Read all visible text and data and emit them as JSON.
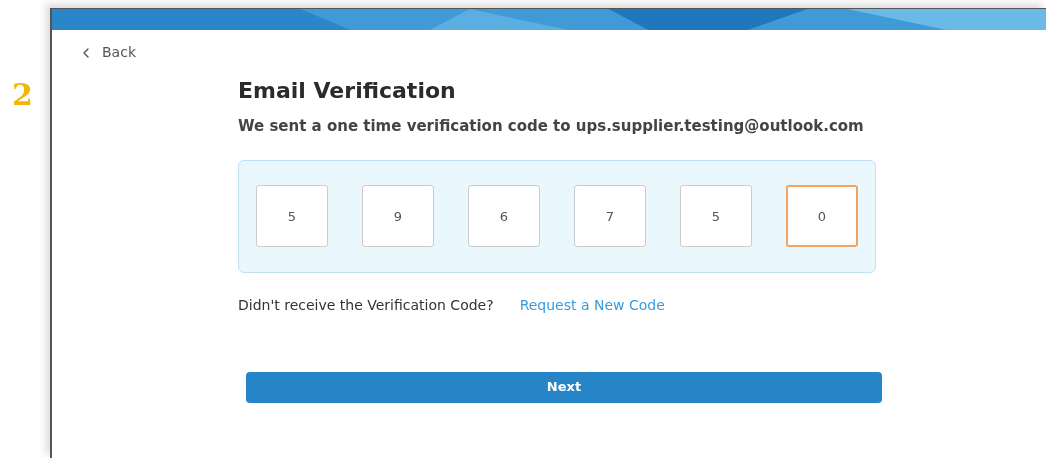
{
  "step_number": "2",
  "back_link": "Back",
  "title": "Email Verification",
  "subtitle": "We sent a one time verification code to ups.supplier.testing@outlook.com",
  "code_digits": [
    {
      "value": "5",
      "focused": false
    },
    {
      "value": "9",
      "focused": false
    },
    {
      "value": "6",
      "focused": false
    },
    {
      "value": "7",
      "focused": false
    },
    {
      "value": "5",
      "focused": false
    },
    {
      "value": "0",
      "focused": true
    }
  ],
  "resend_prompt": "Didn't receive the Verification Code?",
  "resend_link": "Request a New Code",
  "next_button": "Next"
}
